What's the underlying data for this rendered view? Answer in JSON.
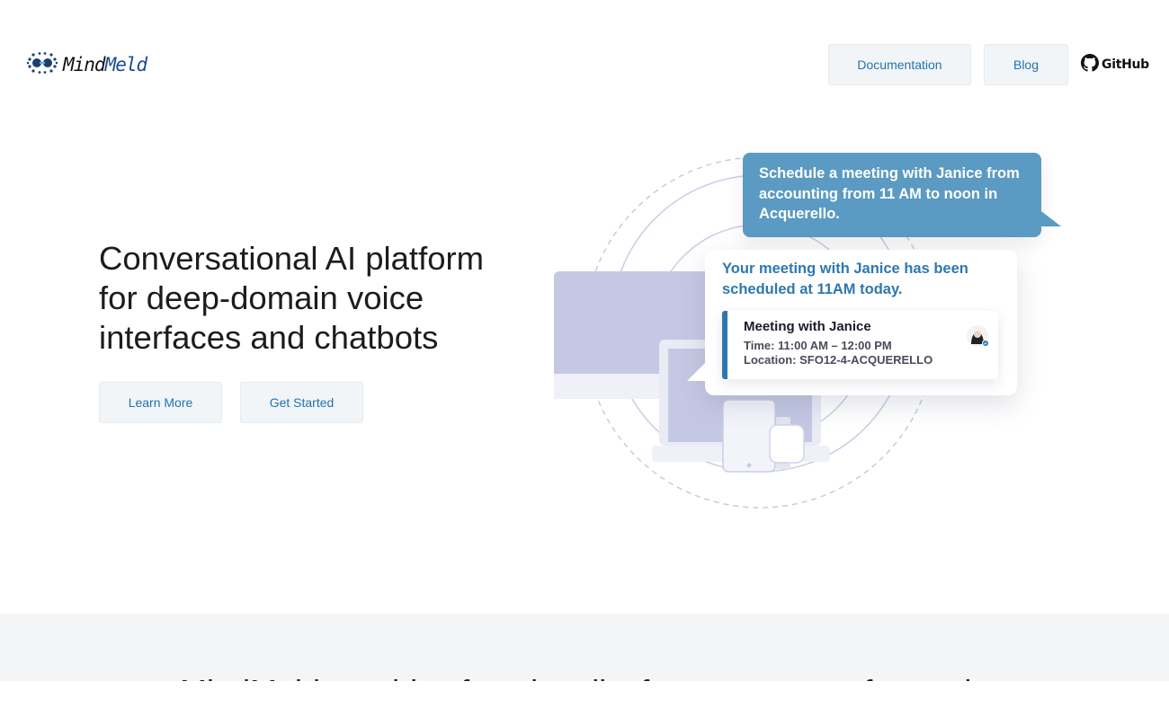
{
  "logo": {
    "text_mind": "Mind",
    "text_meld": "Meld"
  },
  "nav": {
    "documentation": "Documentation",
    "blog": "Blog",
    "github": "GitHub"
  },
  "hero": {
    "title": "Conversational AI platform for deep-domain voice interfaces and chatbots",
    "learn_more": "Learn More",
    "get_started": "Get Started"
  },
  "illustration": {
    "user_message": "Schedule a meeting with Janice from accounting from 11 AM to noon in Acquerello.",
    "bot_reply": "Your meeting with Janice has been scheduled at 11AM today.",
    "card": {
      "title": "Meeting with Janice",
      "time": "Time: 11:00 AM – 12:00 PM",
      "location": "Location: SFO12-4-ACQUERELLO"
    }
  },
  "section2": {
    "heading": "MindMeld provides functionality for every step of a modern"
  },
  "colors": {
    "accent": "#1f74b1",
    "button_bg": "#f1f5f7",
    "user_bubble": "#5b9ac2",
    "band_bg": "#f4f5f7"
  },
  "icons": [
    "mindmeld-logo-icon",
    "github-icon",
    "avatar-icon",
    "checkmark-icon"
  ]
}
